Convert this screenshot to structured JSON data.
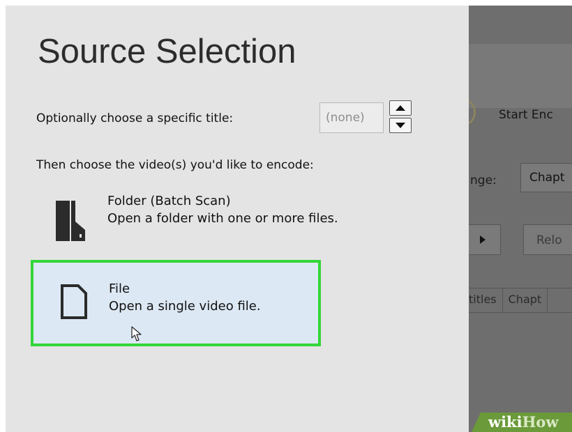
{
  "background_app": {
    "start_encode_label": "Start Enc",
    "range_label": "nge:",
    "range_value": "Chapt",
    "reload_label": "Relo",
    "tabs": [
      "titles",
      "Chapt"
    ]
  },
  "dialog": {
    "title": "Source Selection",
    "title_prompt": "Optionally choose a specific title:",
    "title_select_value": "(none)",
    "encode_prompt": "Then choose the video(s) you'd like to encode:",
    "folder_option": {
      "title": "Folder (Batch Scan)",
      "description": "Open a folder with one or more files.",
      "icon": "folder-icon"
    },
    "file_option": {
      "title": "File",
      "description": "Open a single video file.",
      "icon": "file-icon",
      "highlight_color": "#33d639"
    }
  },
  "watermark": {
    "wiki": "wiki",
    "how": "How"
  },
  "colors": {
    "panel_bg": "#e4e4e4",
    "selection_bg": "#dce8f4",
    "highlight": "#33d639",
    "dimmed_app": "#6e6e6e"
  }
}
